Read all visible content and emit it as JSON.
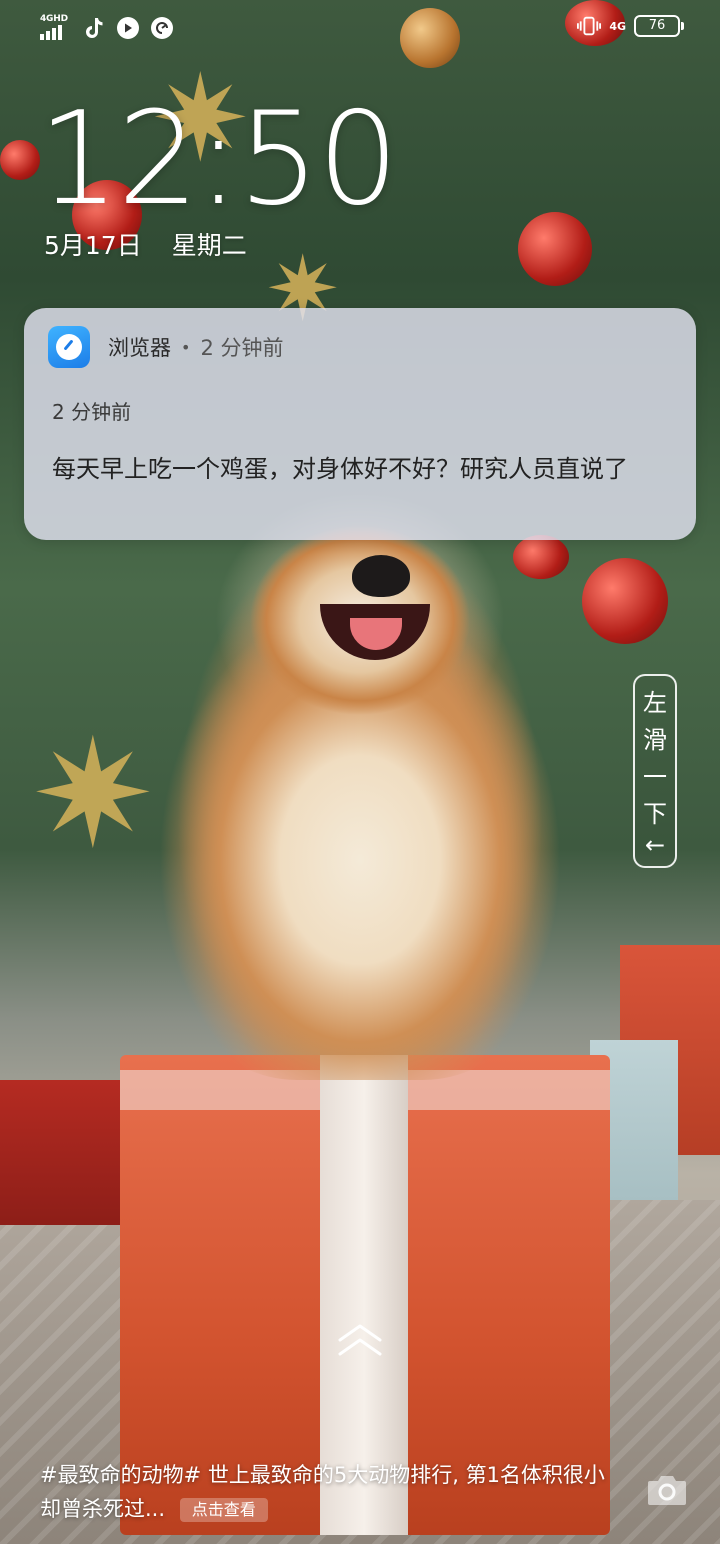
{
  "status_bar": {
    "network_type": "4GHD",
    "mobile_data": "4G",
    "battery": "76",
    "icons": [
      "signal-icon",
      "tiktok-icon",
      "app-play-icon",
      "browser-gauge-icon",
      "vibrate-icon"
    ]
  },
  "lock_screen": {
    "time": "12:50",
    "date": "5月17日",
    "weekday": "星期二"
  },
  "notification": {
    "app_name": "浏览器",
    "separator": "•",
    "time_ago": "2 分钟前",
    "subtitle": "2 分钟前",
    "body": "每天早上吃一个鸡蛋，对身体好不好？研究人员直说了"
  },
  "swipe_hint": {
    "chars": [
      "左",
      "滑",
      "一",
      "下",
      "←"
    ]
  },
  "caption": {
    "text": "#最致命的动物# 世上最致命的5大动物排行, 第1名体积很小却曾杀死过...",
    "button_label": "点击查看"
  },
  "colors": {
    "notification_bg": "#E2E2F0",
    "app_icon_blue": "#1C7DE8",
    "text_white": "#FFFFFF"
  }
}
